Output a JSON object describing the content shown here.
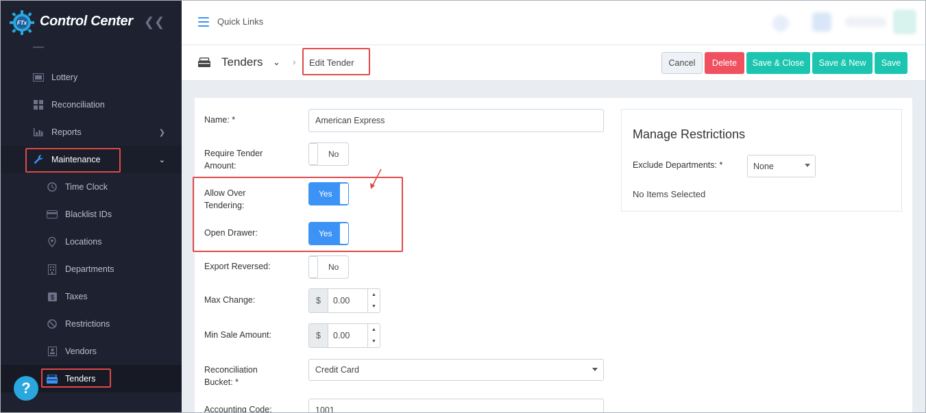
{
  "app": {
    "brand_name": "Control Center",
    "logo_badge": "FTx",
    "brand_color": "#2aa7df"
  },
  "sidebar": {
    "items": [
      {
        "label": "Lottery",
        "icon": "ticket-icon"
      },
      {
        "label": "Reconciliation",
        "icon": "grid-icon"
      },
      {
        "label": "Reports",
        "icon": "bar-chart-icon",
        "has_submenu": true
      },
      {
        "label": "Maintenance",
        "icon": "wrench-icon",
        "expanded": true
      },
      {
        "label": "Time Clock",
        "icon": "clock-icon"
      },
      {
        "label": "Blacklist IDs",
        "icon": "card-icon"
      },
      {
        "label": "Locations",
        "icon": "map-pin-icon"
      },
      {
        "label": "Departments",
        "icon": "building-icon"
      },
      {
        "label": "Taxes",
        "icon": "dollar-icon"
      },
      {
        "label": "Restrictions",
        "icon": "ban-icon"
      },
      {
        "label": "Vendors",
        "icon": "contact-icon"
      },
      {
        "label": "Tenders",
        "icon": "tender-icon",
        "active": true
      }
    ],
    "help_label": "?"
  },
  "topbar": {
    "quick_links": "Quick Links"
  },
  "header": {
    "title": "Tenders",
    "breadcrumb_current": "Edit Tender",
    "buttons": {
      "cancel": "Cancel",
      "delete": "Delete",
      "save_close": "Save & Close",
      "save_new": "Save & New",
      "save": "Save"
    }
  },
  "form": {
    "name": {
      "label": "Name: *",
      "value": "American Express"
    },
    "require_tender_amount": {
      "label": "Require Tender Amount:",
      "value": "No"
    },
    "allow_over_tendering": {
      "label": "Allow Over Tendering:",
      "value": "Yes"
    },
    "open_drawer": {
      "label": "Open Drawer:",
      "value": "Yes"
    },
    "export_reversed": {
      "label": "Export Reversed:",
      "value": "No"
    },
    "max_change": {
      "label": "Max Change:",
      "currency": "$",
      "value": "0.00"
    },
    "min_sale_amount": {
      "label": "Min Sale Amount:",
      "currency": "$",
      "value": "0.00"
    },
    "reconciliation_bucket": {
      "label": "Reconciliation Bucket: *",
      "value": "Credit Card"
    },
    "accounting_code": {
      "label": "Accounting Code:",
      "value": "1001"
    }
  },
  "restrictions": {
    "title": "Manage Restrictions",
    "exclude_label": "Exclude Departments: *",
    "exclude_value": "None",
    "empty_text": "No Items Selected"
  }
}
